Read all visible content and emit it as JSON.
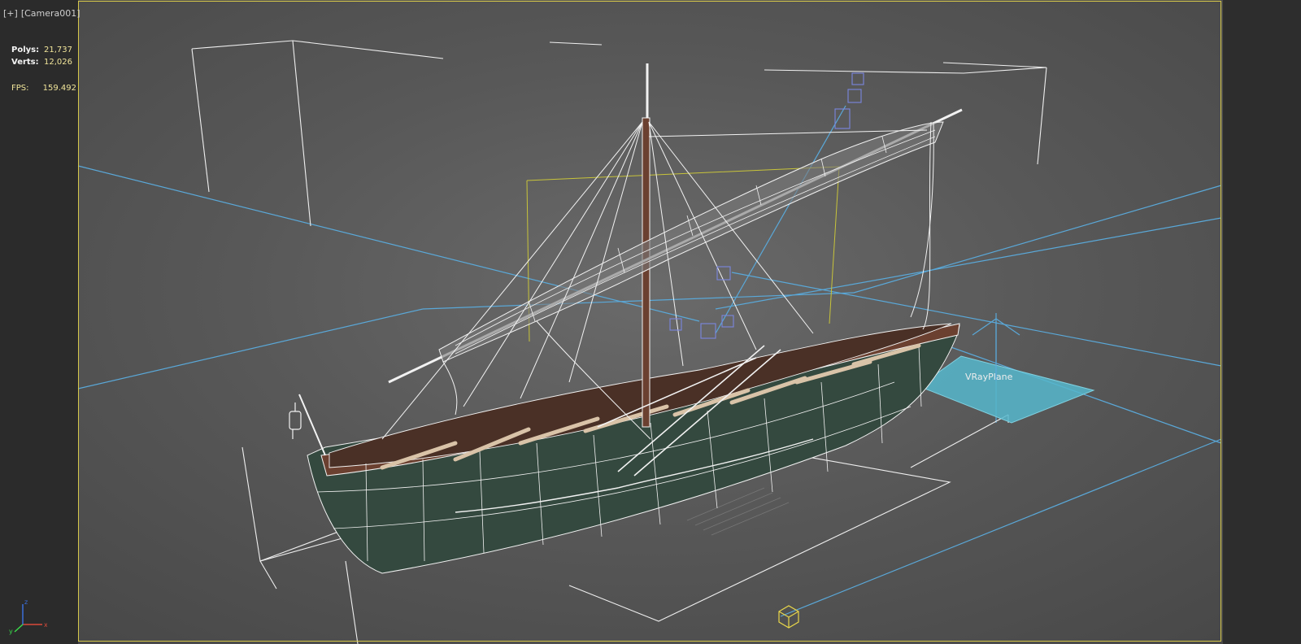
{
  "viewport": {
    "label_plus": "[+]",
    "label_camera": "[Camera001]"
  },
  "stats": {
    "polys_label": "Polys:",
    "polys_value": "21,737",
    "verts_label": "Verts:",
    "verts_value": "12,026",
    "fps_label": "FPS:",
    "fps_value": "159.492"
  },
  "scene": {
    "plane_label": "VRayPlane"
  },
  "colors": {
    "frame": "#d6c84a",
    "wire": "#f2f2f2",
    "hull_wood": "#6b4030",
    "hull_green": "#34493f",
    "plane": "#56b7cc",
    "grid_line": "#5aa8d8",
    "bbox": "#c8c43a"
  },
  "icons": {
    "axis": "axis-tripod-icon",
    "light": "target-helper-icon"
  }
}
